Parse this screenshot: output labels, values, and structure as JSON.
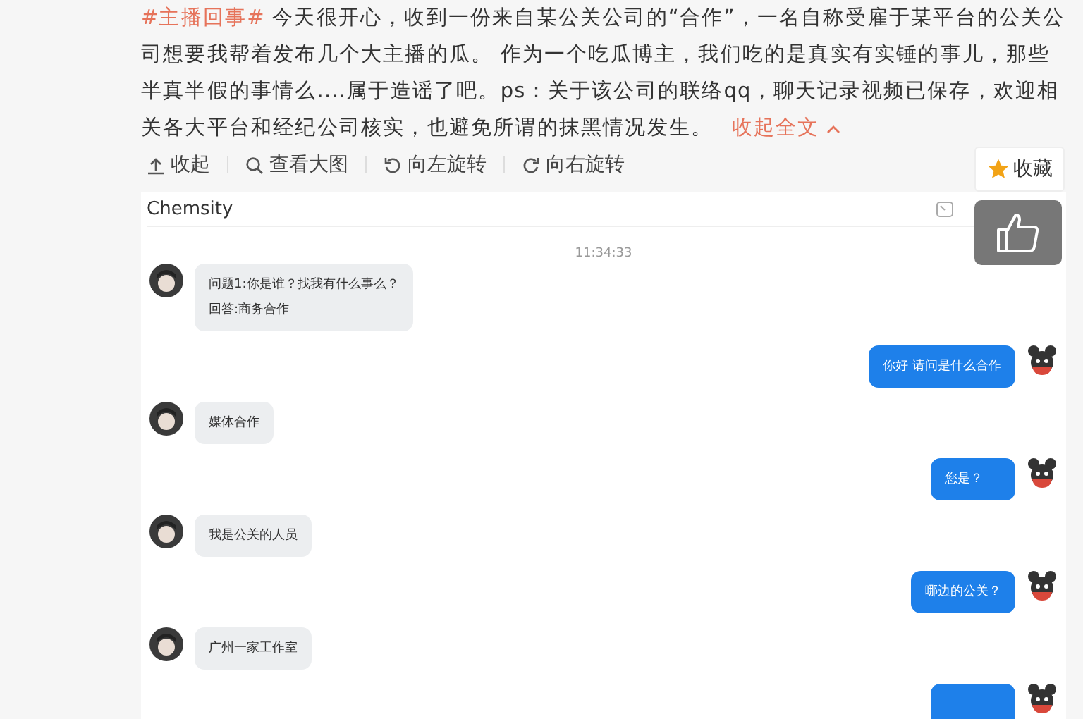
{
  "post": {
    "hashtag": "#主播回事#",
    "text": "今天很开心，收到一份来自某公关公司的“合作”，一名自称受雇于某平台的公关公司想要我帮着发布几个大主播的瓜。 作为一个吃瓜博主，我们吃的是真实有实锤的事儿，那些半真半假的事情么....属于造谣了吧。ps：关于该公司的联络qq，聊天记录视频已保存，欢迎相关各大平台和经纪公司核实，也避免所谓的抹黑情况发生。",
    "collapse_link": "收起全文"
  },
  "toolbar": [
    {
      "kind": "collapse",
      "label": "收起"
    },
    {
      "kind": "zoom",
      "label": "查看大图"
    },
    {
      "kind": "rotate-left",
      "label": "向左旋转"
    },
    {
      "kind": "rotate-right",
      "label": "向右旋转"
    }
  ],
  "favorite_button": "收藏",
  "chat": {
    "title": "Chemsity",
    "timestamp": "11:34:33",
    "messages": [
      {
        "kind": "incoming",
        "lines": [
          "问题1:你是谁？找我有什么事么？",
          "回答:商务合作"
        ]
      },
      {
        "kind": "outgoing",
        "lines": [
          "你好 请问是什么合作"
        ]
      },
      {
        "kind": "incoming",
        "lines": [
          "媒体合作"
        ]
      },
      {
        "kind": "outgoing",
        "lines": [
          "您是？"
        ]
      },
      {
        "kind": "incoming",
        "lines": [
          "我是公关的人员"
        ]
      },
      {
        "kind": "outgoing",
        "lines": [
          "哪边的公关？"
        ]
      },
      {
        "kind": "incoming",
        "lines": [
          "广州一家工作室"
        ]
      },
      {
        "kind": "outgoing"
      }
    ]
  }
}
